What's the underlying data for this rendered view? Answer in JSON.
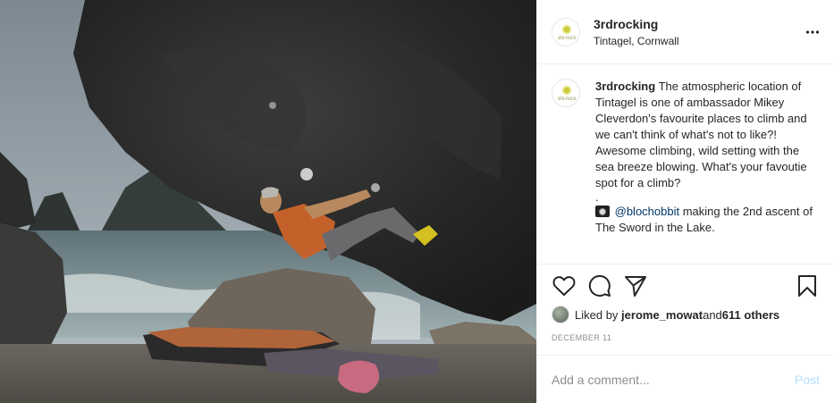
{
  "post": {
    "account": "3rdrocking",
    "location": "Tintagel, Cornwall",
    "avatar_tag": "3RD ROCK",
    "caption": {
      "username": "3rdrocking",
      "text": " The atmospheric location of Tintagel is one of ambassador Mikey Cleverdon's favourite places to climb and we can't think of what's not to like?! Awesome climbing, wild setting with the sea breeze blowing. What's your favoutie spot for a climb?",
      "dot": ".",
      "mention": "@blochobbit",
      "credit_text": " making the 2nd ascent of The Sword in the Lake."
    },
    "likes": {
      "prefix": "Liked by ",
      "user": "jerome_mowat",
      "middle": " and ",
      "others": "611 others"
    },
    "date": "December 11",
    "comment": {
      "placeholder": "Add a comment...",
      "post_label": "Post"
    }
  },
  "icons": {
    "more": "more-horizontal-icon",
    "like": "heart-icon",
    "comment": "comment-bubble-icon",
    "share": "paper-plane-icon",
    "save": "bookmark-icon",
    "camera": "camera-icon"
  },
  "colors": {
    "text": "#262626",
    "secondary": "#8e8e8e",
    "border": "#efefef",
    "mention": "#00376b",
    "post_disabled": "#b2dffc"
  }
}
